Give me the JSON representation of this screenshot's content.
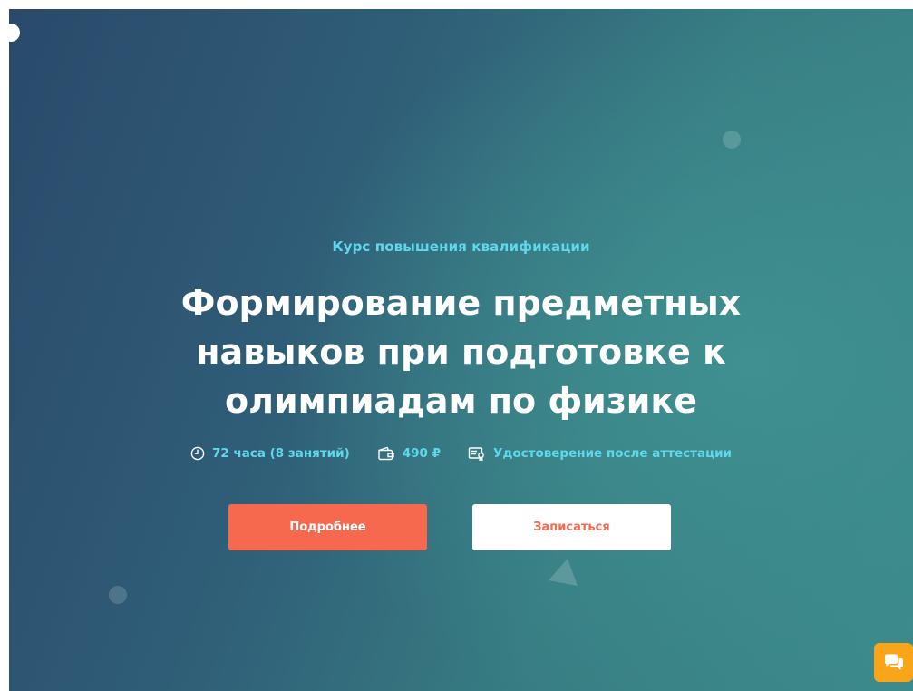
{
  "hero": {
    "subtitle": "Курс повышения квалификации",
    "title_lines": [
      "Формирование предметных",
      "навыков при подготовке к",
      "олимпиадам по физике"
    ],
    "meta": {
      "duration": "72 часа (8 занятий)",
      "price": "490 ₽",
      "certificate": "Удостоверение после аттестации"
    },
    "buttons": {
      "more_label": "Подробнее",
      "enroll_label": "Записаться"
    }
  },
  "icons": {
    "duration": "clock-icon",
    "price": "wallet-icon",
    "certificate": "certificate-icon",
    "chat": "chat-icon"
  },
  "colors": {
    "accent_cyan": "#5fd8ec",
    "primary_button": "#f6694f",
    "chat_button": "#f9a51a",
    "background_start": "#2a4a6b",
    "background_end": "#3c8a8a"
  }
}
